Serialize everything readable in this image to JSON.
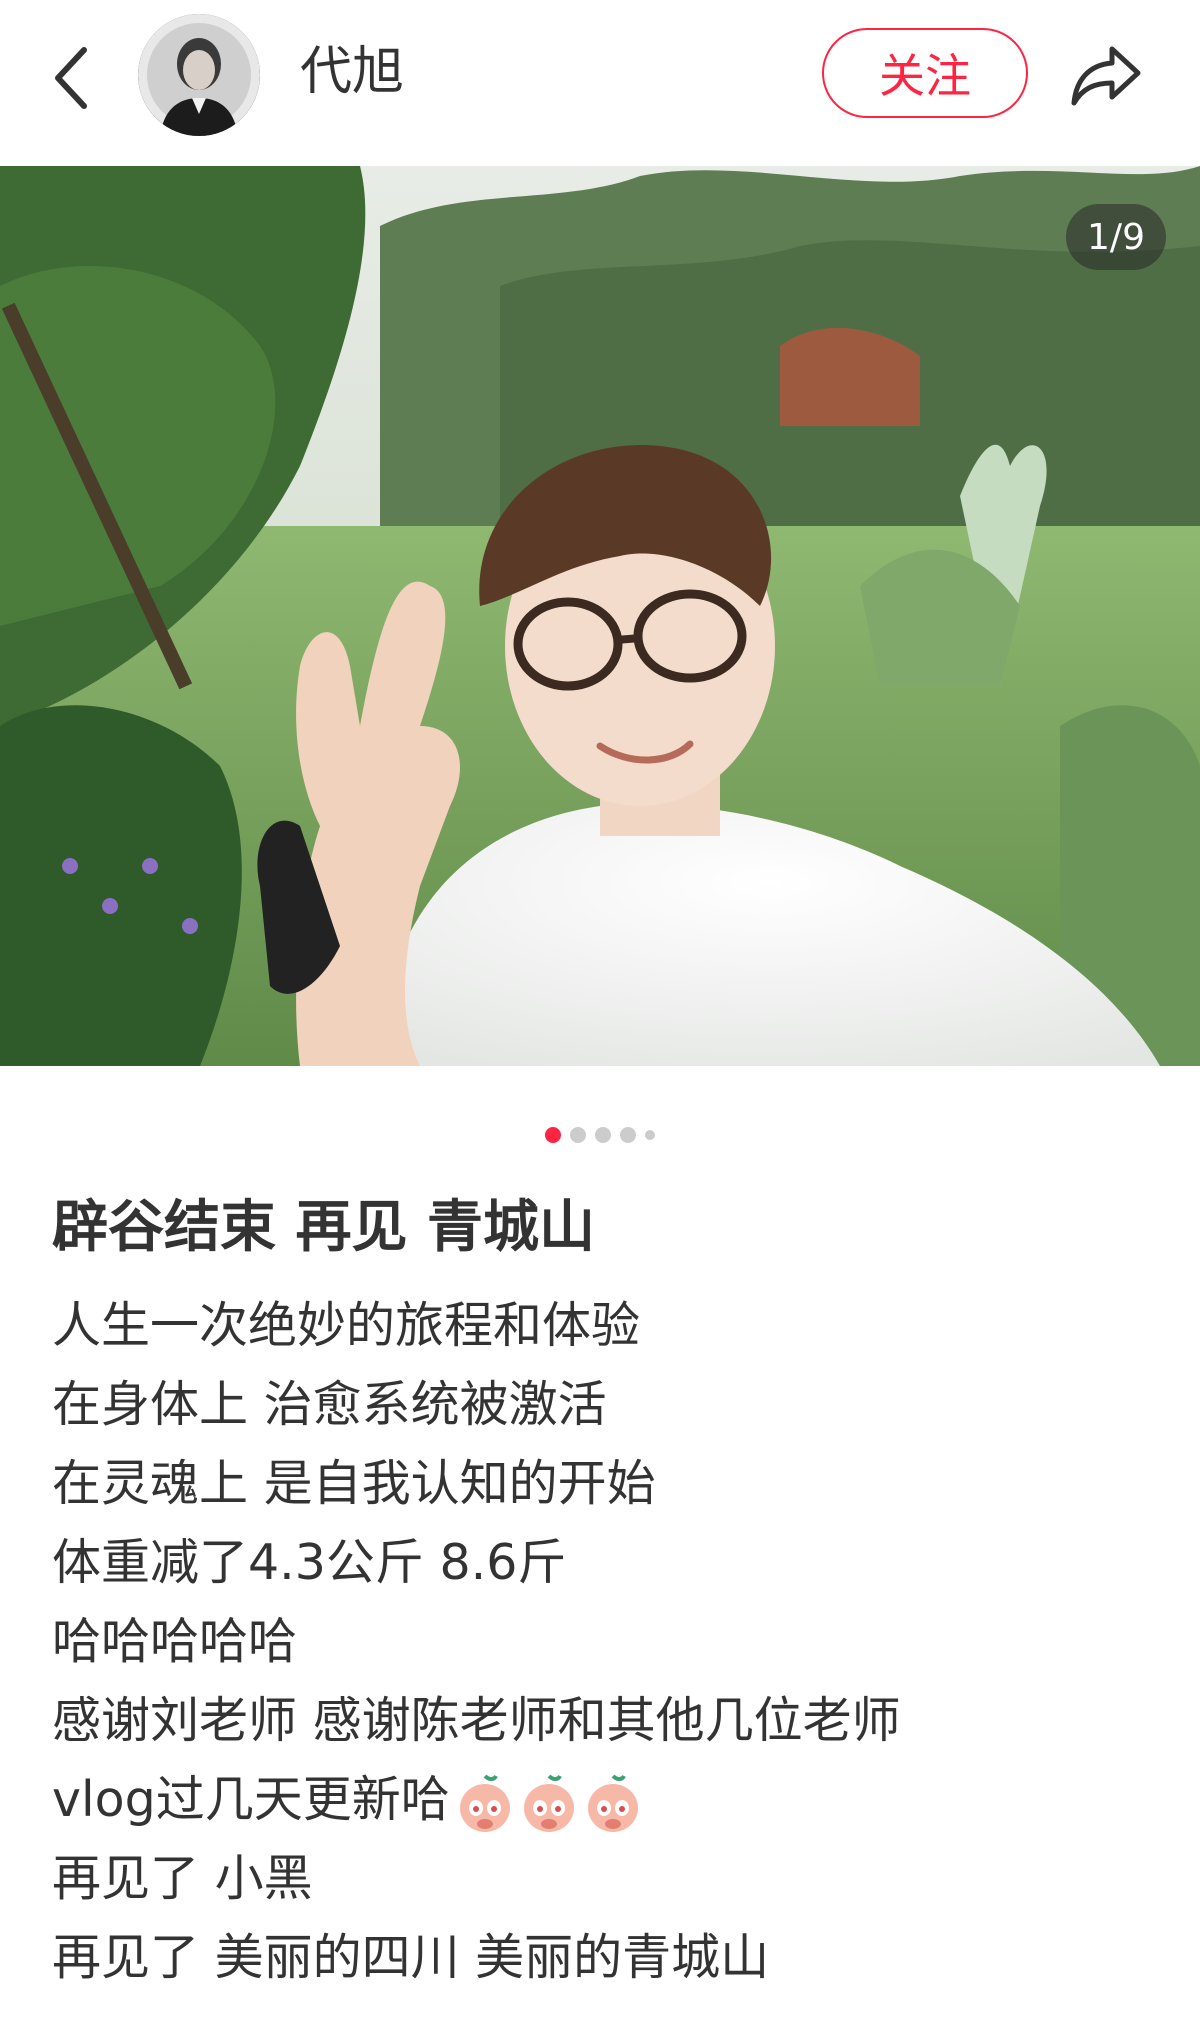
{
  "header": {
    "username": "代旭",
    "follow_label": "关注",
    "icons": {
      "back": "chevron-left-icon",
      "share": "share-arrow-icon"
    }
  },
  "gallery": {
    "counter": "1/9",
    "current_index": 1,
    "total": 9
  },
  "post": {
    "title": "辟谷结束 再见 青城山",
    "lines": [
      "人生一次绝妙的旅程和体验",
      "在身体上 治愈系统被激活",
      "在灵魂上 是自我认知的开始",
      "体重减了4.3公斤 8.6斤",
      "哈哈哈哈哈",
      "感谢刘老师 感谢陈老师和其他几位老师",
      "vlog过几天更新哈",
      "再见了 小黑",
      "再见了 美丽的四川 美丽的青城山"
    ]
  },
  "colors": {
    "accent": "#ff2442",
    "text": "#333333",
    "dot_inactive": "#cccccc"
  }
}
